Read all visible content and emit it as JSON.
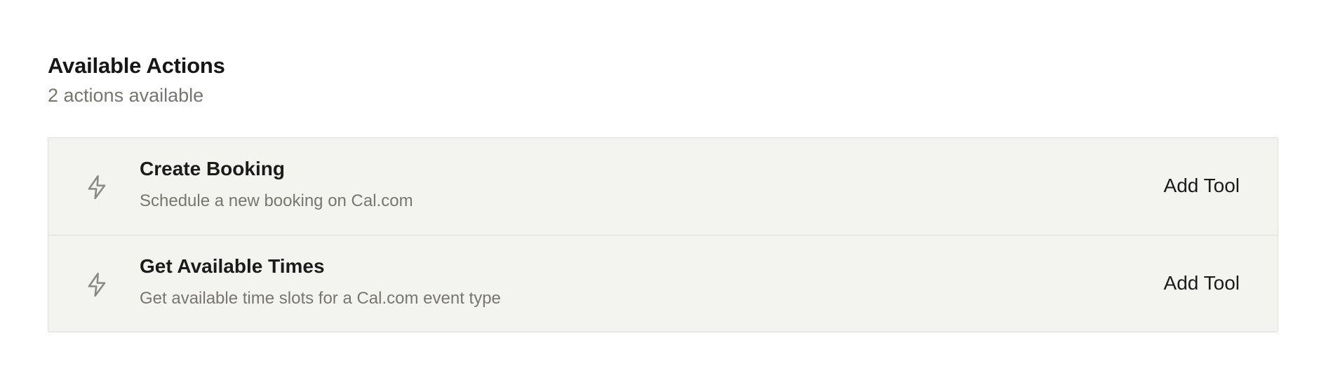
{
  "header": {
    "title": "Available Actions",
    "subtitle": "2 actions available"
  },
  "actions": [
    {
      "icon": "lightning-icon",
      "name": "Create Booking",
      "description": "Schedule a new booking on Cal.com",
      "button_label": "Add Tool"
    },
    {
      "icon": "lightning-icon",
      "name": "Get Available Times",
      "description": "Get available time slots for a Cal.com event type",
      "button_label": "Add Tool"
    }
  ],
  "colors": {
    "card_background": "#f3f3ef",
    "border": "#dedddb",
    "muted_text": "#76756f",
    "icon": "#8a8983"
  }
}
